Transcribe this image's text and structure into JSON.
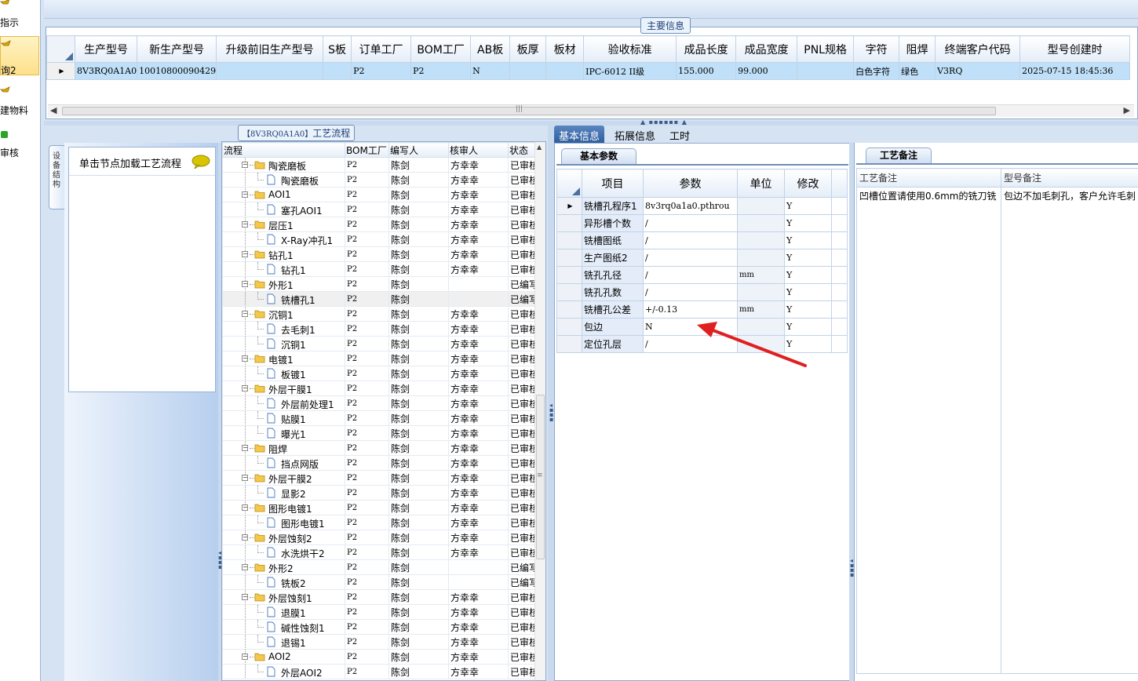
{
  "nav": {
    "items": [
      {
        "label": "指示",
        "icon": "folder-arrow-icon"
      },
      {
        "label": "询2",
        "icon": "folder-arrow-icon",
        "active": true
      },
      {
        "label": "建物料",
        "icon": "folder-arrow-icon"
      },
      {
        "label": "审核",
        "icon": "green-dot-icon"
      }
    ]
  },
  "main": {
    "title": "主要信息",
    "columns": [
      "生产型号",
      "新生产型号",
      "升级前旧生产型号",
      "S板",
      "订单工厂",
      "BOM工厂",
      "AB板",
      "板厚",
      "板材",
      "验收标准",
      "成品长度",
      "成品宽度",
      "PNL规格",
      "字符",
      "阻焊",
      "终端客户代码",
      "型号创建时"
    ],
    "row": [
      "8V3RQ0A1A0",
      "10010800090429",
      "",
      "",
      "P2",
      "P2",
      "N",
      "",
      "",
      "IPC-6012 II级",
      "155.000",
      "99.000",
      "",
      "白色字符",
      "绿色",
      "V3RQ",
      "2025-07-15 18:45:36"
    ]
  },
  "leftTab": {
    "label": "设备结构"
  },
  "loadHint": "单击节点加载工艺流程",
  "process": {
    "title_code": "【8V3RQ0A1A0】",
    "title_text": "工艺流程",
    "columns": [
      "流程",
      "BOM工厂",
      "编写人",
      "核审人",
      "状态"
    ],
    "rows": [
      {
        "level": 1,
        "name": "陶瓷磨板",
        "bom": "P2",
        "writer": "陈剑",
        "reviewer": "方幸幸",
        "status": "已审核"
      },
      {
        "level": 2,
        "name": "陶瓷磨板",
        "bom": "P2",
        "writer": "陈剑",
        "reviewer": "方幸幸",
        "status": "已审核"
      },
      {
        "level": 1,
        "name": "AOI1",
        "bom": "P2",
        "writer": "陈剑",
        "reviewer": "方幸幸",
        "status": "已审核"
      },
      {
        "level": 2,
        "name": "塞孔AOI1",
        "bom": "P2",
        "writer": "陈剑",
        "reviewer": "方幸幸",
        "status": "已审核"
      },
      {
        "level": 1,
        "name": "层压1",
        "bom": "P2",
        "writer": "陈剑",
        "reviewer": "方幸幸",
        "status": "已审核"
      },
      {
        "level": 2,
        "name": "X-Ray冲孔1",
        "bom": "P2",
        "writer": "陈剑",
        "reviewer": "方幸幸",
        "status": "已审核"
      },
      {
        "level": 1,
        "name": "钻孔1",
        "bom": "P2",
        "writer": "陈剑",
        "reviewer": "方幸幸",
        "status": "已审核"
      },
      {
        "level": 2,
        "name": "钻孔1",
        "bom": "P2",
        "writer": "陈剑",
        "reviewer": "方幸幸",
        "status": "已审核"
      },
      {
        "level": 1,
        "name": "外形1",
        "bom": "P2",
        "writer": "陈剑",
        "reviewer": "",
        "status": "已编写"
      },
      {
        "level": 2,
        "name": "铣槽孔1",
        "bom": "P2",
        "writer": "陈剑",
        "reviewer": "",
        "status": "已编写",
        "selected": true
      },
      {
        "level": 1,
        "name": "沉铜1",
        "bom": "P2",
        "writer": "陈剑",
        "reviewer": "方幸幸",
        "status": "已审核"
      },
      {
        "level": 2,
        "name": "去毛刺1",
        "bom": "P2",
        "writer": "陈剑",
        "reviewer": "方幸幸",
        "status": "已审核"
      },
      {
        "level": 2,
        "name": "沉铜1",
        "bom": "P2",
        "writer": "陈剑",
        "reviewer": "方幸幸",
        "status": "已审核"
      },
      {
        "level": 1,
        "name": "电镀1",
        "bom": "P2",
        "writer": "陈剑",
        "reviewer": "方幸幸",
        "status": "已审核"
      },
      {
        "level": 2,
        "name": "板镀1",
        "bom": "P2",
        "writer": "陈剑",
        "reviewer": "方幸幸",
        "status": "已审核"
      },
      {
        "level": 1,
        "name": "外层干膜1",
        "bom": "P2",
        "writer": "陈剑",
        "reviewer": "方幸幸",
        "status": "已审核"
      },
      {
        "level": 2,
        "name": "外层前处理1",
        "bom": "P2",
        "writer": "陈剑",
        "reviewer": "方幸幸",
        "status": "已审核"
      },
      {
        "level": 2,
        "name": "贴膜1",
        "bom": "P2",
        "writer": "陈剑",
        "reviewer": "方幸幸",
        "status": "已审核"
      },
      {
        "level": 2,
        "name": "曝光1",
        "bom": "P2",
        "writer": "陈剑",
        "reviewer": "方幸幸",
        "status": "已审核"
      },
      {
        "level": 1,
        "name": "阻焊",
        "bom": "P2",
        "writer": "陈剑",
        "reviewer": "方幸幸",
        "status": "已审核"
      },
      {
        "level": 2,
        "name": "挡点网版",
        "bom": "P2",
        "writer": "陈剑",
        "reviewer": "方幸幸",
        "status": "已审核"
      },
      {
        "level": 1,
        "name": "外层干膜2",
        "bom": "P2",
        "writer": "陈剑",
        "reviewer": "方幸幸",
        "status": "已审核"
      },
      {
        "level": 2,
        "name": "显影2",
        "bom": "P2",
        "writer": "陈剑",
        "reviewer": "方幸幸",
        "status": "已审核"
      },
      {
        "level": 1,
        "name": "图形电镀1",
        "bom": "P2",
        "writer": "陈剑",
        "reviewer": "方幸幸",
        "status": "已审核"
      },
      {
        "level": 2,
        "name": "图形电镀1",
        "bom": "P2",
        "writer": "陈剑",
        "reviewer": "方幸幸",
        "status": "已审核"
      },
      {
        "level": 1,
        "name": "外层蚀刻2",
        "bom": "P2",
        "writer": "陈剑",
        "reviewer": "方幸幸",
        "status": "已审核"
      },
      {
        "level": 2,
        "name": "水洗烘干2",
        "bom": "P2",
        "writer": "陈剑",
        "reviewer": "方幸幸",
        "status": "已审核"
      },
      {
        "level": 1,
        "name": "外形2",
        "bom": "P2",
        "writer": "陈剑",
        "reviewer": "",
        "status": "已编写"
      },
      {
        "level": 2,
        "name": "铣板2",
        "bom": "P2",
        "writer": "陈剑",
        "reviewer": "",
        "status": "已编写"
      },
      {
        "level": 1,
        "name": "外层蚀刻1",
        "bom": "P2",
        "writer": "陈剑",
        "reviewer": "方幸幸",
        "status": "已审核"
      },
      {
        "level": 2,
        "name": "退膜1",
        "bom": "P2",
        "writer": "陈剑",
        "reviewer": "方幸幸",
        "status": "已审核"
      },
      {
        "level": 2,
        "name": "碱性蚀刻1",
        "bom": "P2",
        "writer": "陈剑",
        "reviewer": "方幸幸",
        "status": "已审核"
      },
      {
        "level": 2,
        "name": "退锡1",
        "bom": "P2",
        "writer": "陈剑",
        "reviewer": "方幸幸",
        "status": "已审核"
      },
      {
        "level": 1,
        "name": "AOI2",
        "bom": "P2",
        "writer": "陈剑",
        "reviewer": "方幸幸",
        "status": "已审核"
      },
      {
        "level": 2,
        "name": "外层AOI2",
        "bom": "P2",
        "writer": "陈剑",
        "reviewer": "方幸幸",
        "status": "已审核"
      }
    ]
  },
  "midTabs": [
    "基本信息",
    "拓展信息",
    "工时"
  ],
  "params": {
    "tab": "基本参数",
    "columns": [
      "项目",
      "参数",
      "单位",
      "修改"
    ],
    "rows": [
      {
        "item": "铣槽孔程序1",
        "value": "8v3rq0a1a0.pthrou",
        "unit": "",
        "edit": "Y"
      },
      {
        "item": "异形槽个数",
        "value": "/",
        "unit": "",
        "edit": "Y"
      },
      {
        "item": "铣槽图纸",
        "value": "/",
        "unit": "",
        "edit": "Y"
      },
      {
        "item": "生产图纸2",
        "value": "/",
        "unit": "",
        "edit": "Y"
      },
      {
        "item": "铣孔孔径",
        "value": "/",
        "unit": "mm",
        "edit": "Y"
      },
      {
        "item": "铣孔孔数",
        "value": "/",
        "unit": "",
        "edit": "Y"
      },
      {
        "item": "铣槽孔公差",
        "value": "+/-0.13",
        "unit": "mm",
        "edit": "Y"
      },
      {
        "item": "包边",
        "value": "N",
        "unit": "",
        "edit": "Y"
      },
      {
        "item": "定位孔层",
        "value": "/",
        "unit": "",
        "edit": "Y"
      }
    ]
  },
  "remarks": {
    "tab": "工艺备注",
    "columns": [
      "工艺备注",
      "型号备注"
    ],
    "process_note": "凹槽位置请使用0.6mm的铣刀铣",
    "model_note": "包边不加毛刺孔，客户允许毛刺"
  },
  "colors": {
    "accent": "#2e5e9e",
    "selection": "#bfe0f8",
    "annotation": "#e02020"
  }
}
